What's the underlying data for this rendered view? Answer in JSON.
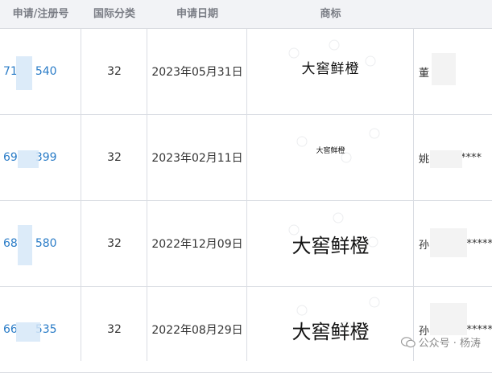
{
  "headers": [
    "申请/注册号",
    "国际分类",
    "申请日期",
    "商标",
    ""
  ],
  "rows": [
    {
      "regno_prefix": "71",
      "regno_suffix": "540",
      "class": "32",
      "date": "2023年05月31日",
      "trademark": "大窖鲜橙",
      "tm_size": "small-serif",
      "applicant": "董",
      "applicant_mask": ""
    },
    {
      "regno_prefix": "69",
      "regno_suffix": "399",
      "class": "32",
      "date": "2023年02月11日",
      "trademark": "大窖鲜橙",
      "tm_size": "tiny",
      "applicant": "姚",
      "applicant_mask": "******"
    },
    {
      "regno_prefix": "68",
      "regno_suffix": "580",
      "class": "32",
      "date": "2022年12月09日",
      "trademark": "大窖鲜橙",
      "tm_size": "large",
      "applicant": "孙",
      "applicant_mask": "******"
    },
    {
      "regno_prefix": "66",
      "regno_suffix": "535",
      "class": "32",
      "date": "2022年08月29日",
      "trademark": "大窖鲜橙",
      "tm_size": "large",
      "applicant": "孙",
      "applicant_mask": "******"
    }
  ],
  "footer": {
    "text": "公众号 · 杨涛"
  },
  "icons": {
    "footer": "wechat-icon"
  }
}
